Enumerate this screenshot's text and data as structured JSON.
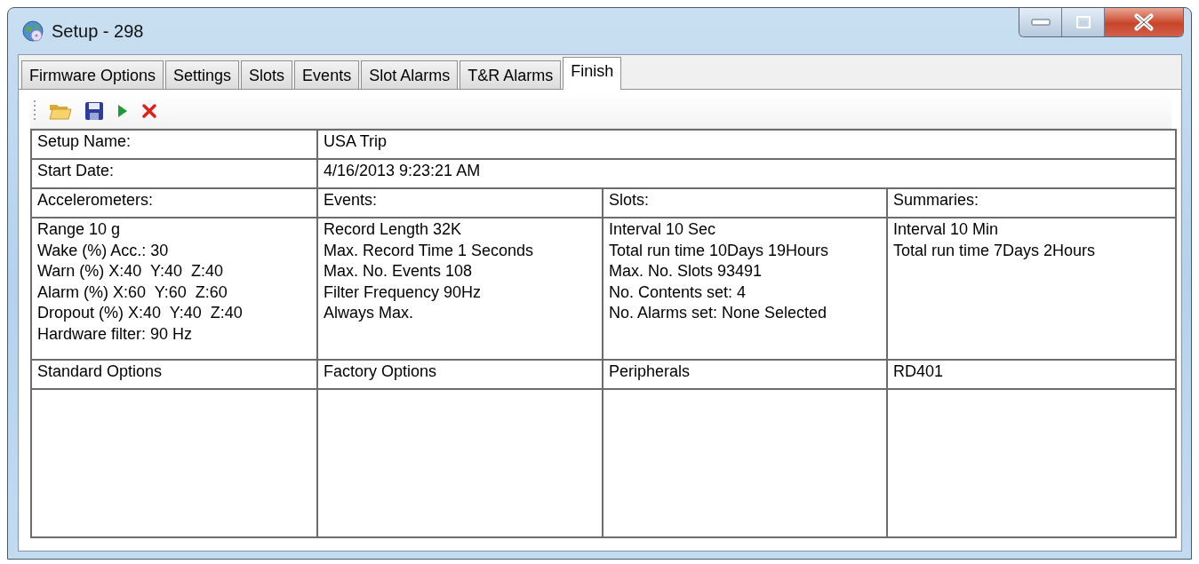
{
  "window": {
    "title": "Setup - 298"
  },
  "tabs": [
    {
      "label": "Firmware Options",
      "selected": false
    },
    {
      "label": "Settings",
      "selected": false
    },
    {
      "label": "Slots",
      "selected": false
    },
    {
      "label": "Events",
      "selected": false
    },
    {
      "label": "Slot Alarms",
      "selected": false
    },
    {
      "label": "T&R Alarms",
      "selected": false
    },
    {
      "label": "Finish",
      "selected": true
    }
  ],
  "grid": {
    "rows": [
      {
        "kind": "field",
        "label": "Setup Name:",
        "value": "USA Trip"
      },
      {
        "kind": "field",
        "label": "Start Date:",
        "value": "4/16/2013 9:23:21 AM"
      },
      {
        "kind": "headers",
        "cells": [
          "Accelerometers:",
          "Events:",
          "Slots:",
          "Summaries:"
        ]
      },
      {
        "kind": "details",
        "cells": [
          [
            "Range 10 g",
            "Wake (%) Acc.: 30",
            "Warn (%) X:40  Y:40  Z:40",
            "Alarm (%) X:60  Y:60  Z:60",
            "Dropout (%) X:40  Y:40  Z:40",
            "Hardware filter: 90 Hz"
          ],
          [
            "Record Length 32K",
            "Max. Record Time 1 Seconds",
            "Max. No. Events 108",
            "Filter Frequency 90Hz",
            "Always Max."
          ],
          [
            "Interval 10 Sec",
            "Total run time 10Days 19Hours",
            "Max. No. Slots 93491",
            "No. Contents set: 4",
            "No. Alarms set: None Selected"
          ],
          [
            "Interval 10 Min",
            "Total run time 7Days 2Hours"
          ]
        ]
      },
      {
        "kind": "headers",
        "cells": [
          "Standard Options",
          "Factory Options",
          "Peripherals",
          "RD401"
        ]
      },
      {
        "kind": "empty"
      }
    ]
  }
}
